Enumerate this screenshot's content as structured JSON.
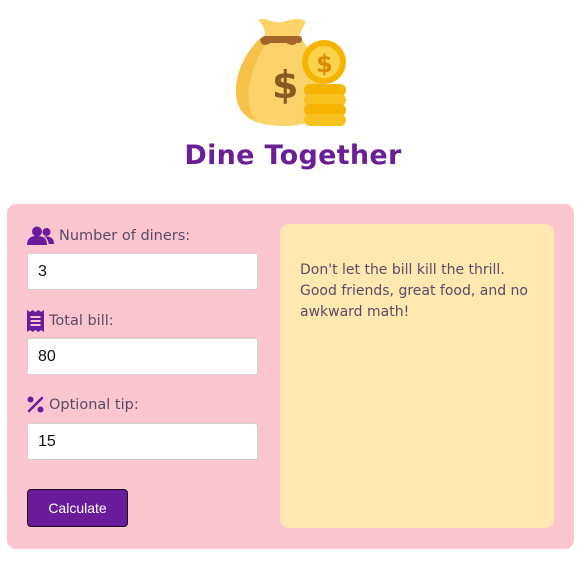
{
  "header": {
    "title": "Dine Together",
    "logo_icon": "money-bag-coins-icon"
  },
  "form": {
    "diners": {
      "label": "Number of diners:",
      "value": "3",
      "icon": "users-icon"
    },
    "bill": {
      "label": "Total bill:",
      "value": "80",
      "icon": "receipt-icon"
    },
    "tip": {
      "label": "Optional tip:",
      "value": "15",
      "icon": "percent-icon"
    },
    "calculate_label": "Calculate"
  },
  "message": {
    "text": "Don't let the bill kill the thrill. Good friends, great food, and no awkward math!"
  },
  "colors": {
    "title": "#6b1f97",
    "card_bg": "#fbc6d0",
    "panel_bg": "#ffe9b0",
    "button_bg": "#6a1b9a",
    "icon": "#6a1b9a"
  }
}
